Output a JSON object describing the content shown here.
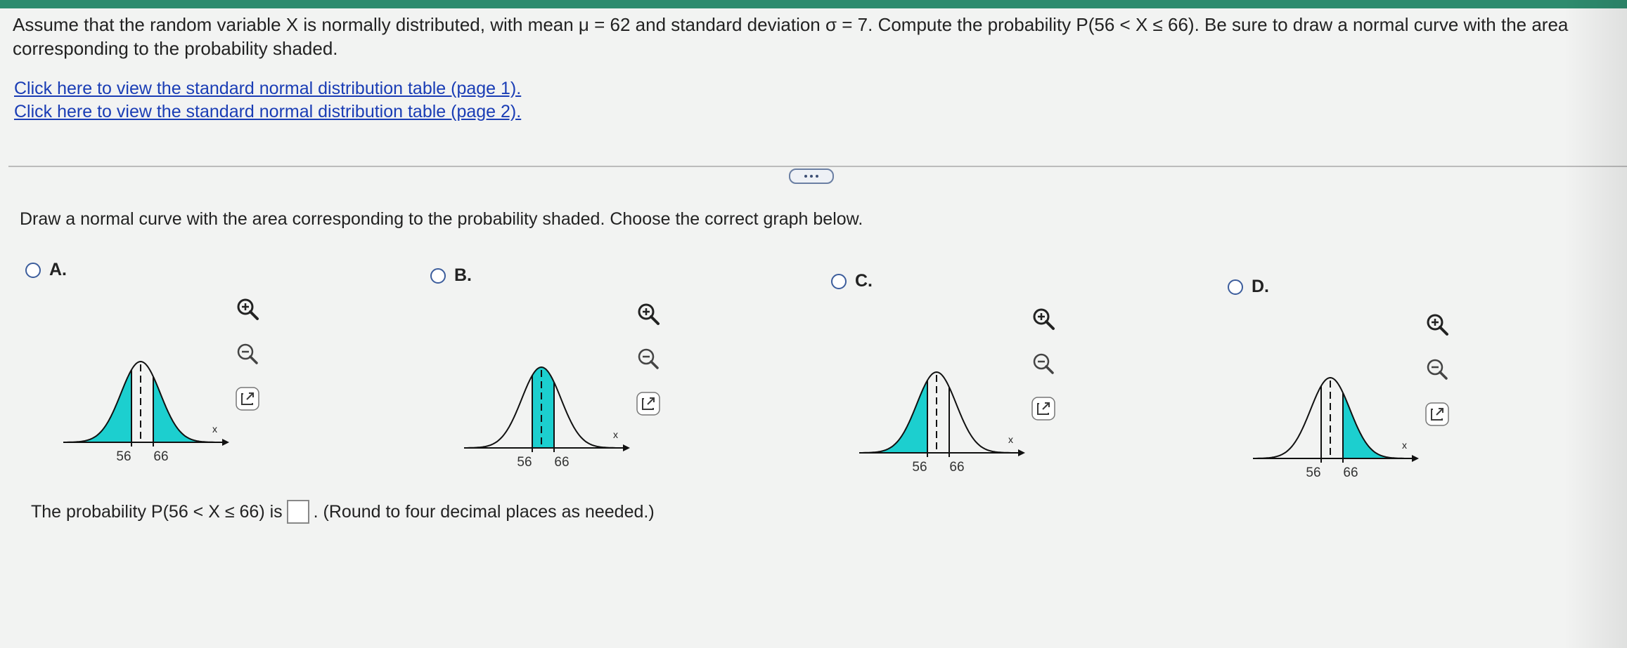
{
  "question": {
    "text": "Assume that the random variable X is normally distributed, with mean μ = 62 and standard deviation σ = 7. Compute the probability P(56 < X ≤ 66). Be sure to draw a normal curve with the area corresponding to the probability shaded."
  },
  "links": [
    "Click here to view the standard normal distribution table (page 1).",
    "Click here to view the standard normal distribution table (page 2)."
  ],
  "instruction": "Draw a normal curve with the area corresponding to the probability shaded. Choose the correct graph below.",
  "options": [
    {
      "letter": "A.",
      "shading": "tails",
      "tick_left": "56",
      "tick_right": "66",
      "axis_label": "x"
    },
    {
      "letter": "B.",
      "shading": "between",
      "tick_left": "56",
      "tick_right": "66",
      "axis_label": "x"
    },
    {
      "letter": "C.",
      "shading": "left",
      "tick_left": "56",
      "tick_right": "66",
      "axis_label": "x"
    },
    {
      "letter": "D.",
      "shading": "right",
      "tick_left": "56",
      "tick_right": "66",
      "axis_label": "x"
    }
  ],
  "answer": {
    "prefix": "The probability P(56 < X ≤ 66) is",
    "suffix": ". (Round to four decimal places as needed.)"
  },
  "colors": {
    "shade": "#1ccfcf",
    "link": "#1a3db5",
    "radio": "#3c5d9c",
    "accent_bar": "#2e8b6e"
  },
  "icons": [
    "zoom-in-icon",
    "zoom-out-icon",
    "open-external-icon"
  ]
}
